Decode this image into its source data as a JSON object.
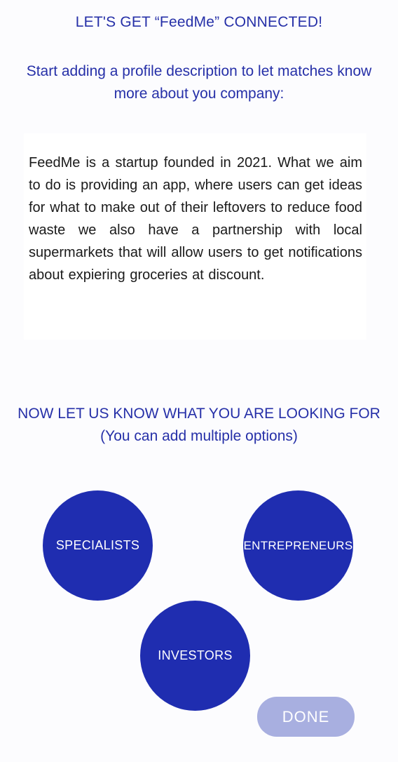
{
  "header": {
    "title": "LET'S GET “FeedMe” CONNECTED!",
    "subtitle": "Start adding a profile description to let matches know more about you company:"
  },
  "description": {
    "text": "FeedMe is a startup founded in 2021. What we aim to do is providing an app, where users can get ideas for what to make out of their leftovers to reduce food waste we also have a partnership with local supermarkets that will allow users to get notifications about expiering groceries at discount."
  },
  "looking_for": {
    "heading": "NOW LET US KNOW WHAT YOU ARE LOOKING FOR",
    "hint": "(You can add multiple options)",
    "options": [
      "SPECIALISTS",
      "ENTREPRENEURS",
      "INVESTORS"
    ]
  },
  "actions": {
    "done_label": "DONE"
  },
  "colors": {
    "accent": "#1f2db0",
    "text_accent": "#2630a8",
    "done_bg": "#a8afe0"
  }
}
